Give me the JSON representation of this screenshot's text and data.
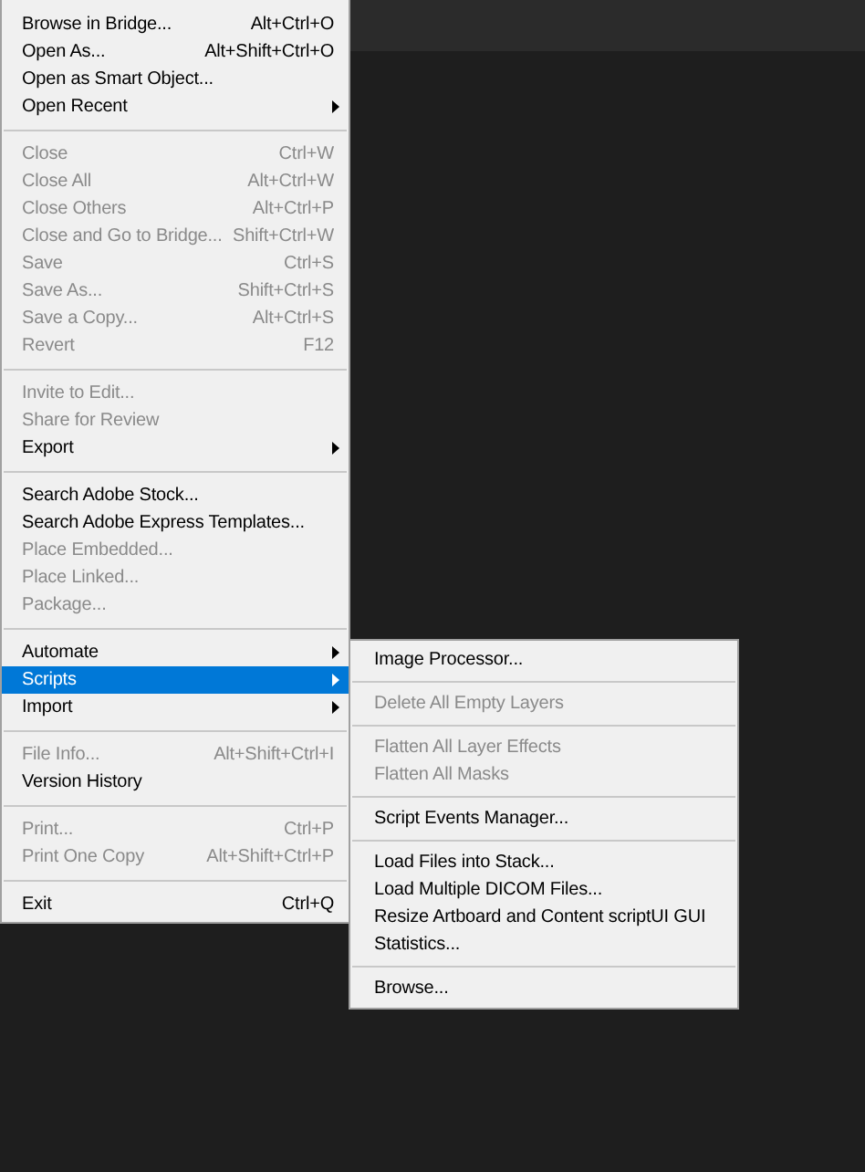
{
  "file_menu": {
    "items": [
      {
        "kind": "item",
        "label": "Browse in Bridge...",
        "shortcut": "Alt+Ctrl+O",
        "disabled": false,
        "has_submenu": false,
        "selected": false
      },
      {
        "kind": "item",
        "label": "Open As...",
        "shortcut": "Alt+Shift+Ctrl+O",
        "disabled": false,
        "has_submenu": false,
        "selected": false
      },
      {
        "kind": "item",
        "label": "Open as Smart Object...",
        "disabled": false,
        "has_submenu": false,
        "selected": false
      },
      {
        "kind": "item",
        "label": "Open Recent",
        "disabled": false,
        "has_submenu": true,
        "selected": false
      },
      {
        "kind": "separator"
      },
      {
        "kind": "item",
        "label": "Close",
        "shortcut": "Ctrl+W",
        "disabled": true,
        "has_submenu": false,
        "selected": false
      },
      {
        "kind": "item",
        "label": "Close All",
        "shortcut": "Alt+Ctrl+W",
        "disabled": true,
        "has_submenu": false,
        "selected": false
      },
      {
        "kind": "item",
        "label": "Close Others",
        "shortcut": "Alt+Ctrl+P",
        "disabled": true,
        "has_submenu": false,
        "selected": false
      },
      {
        "kind": "item",
        "label": "Close and Go to Bridge...",
        "shortcut": "Shift+Ctrl+W",
        "disabled": true,
        "has_submenu": false,
        "selected": false
      },
      {
        "kind": "item",
        "label": "Save",
        "shortcut": "Ctrl+S",
        "disabled": true,
        "has_submenu": false,
        "selected": false
      },
      {
        "kind": "item",
        "label": "Save As...",
        "shortcut": "Shift+Ctrl+S",
        "disabled": true,
        "has_submenu": false,
        "selected": false
      },
      {
        "kind": "item",
        "label": "Save a Copy...",
        "shortcut": "Alt+Ctrl+S",
        "disabled": true,
        "has_submenu": false,
        "selected": false
      },
      {
        "kind": "item",
        "label": "Revert",
        "shortcut": "F12",
        "disabled": true,
        "has_submenu": false,
        "selected": false
      },
      {
        "kind": "separator"
      },
      {
        "kind": "item",
        "label": "Invite to Edit...",
        "disabled": true,
        "has_submenu": false,
        "selected": false
      },
      {
        "kind": "item",
        "label": "Share for Review",
        "disabled": true,
        "has_submenu": false,
        "selected": false
      },
      {
        "kind": "item",
        "label": "Export",
        "disabled": false,
        "has_submenu": true,
        "selected": false
      },
      {
        "kind": "separator"
      },
      {
        "kind": "item",
        "label": "Search Adobe Stock...",
        "disabled": false,
        "has_submenu": false,
        "selected": false
      },
      {
        "kind": "item",
        "label": "Search Adobe Express Templates...",
        "disabled": false,
        "has_submenu": false,
        "selected": false
      },
      {
        "kind": "item",
        "label": "Place Embedded...",
        "disabled": true,
        "has_submenu": false,
        "selected": false
      },
      {
        "kind": "item",
        "label": "Place Linked...",
        "disabled": true,
        "has_submenu": false,
        "selected": false
      },
      {
        "kind": "item",
        "label": "Package...",
        "disabled": true,
        "has_submenu": false,
        "selected": false
      },
      {
        "kind": "separator"
      },
      {
        "kind": "item",
        "label": "Automate",
        "disabled": false,
        "has_submenu": true,
        "selected": false
      },
      {
        "kind": "item",
        "label": "Scripts",
        "disabled": false,
        "has_submenu": true,
        "selected": true
      },
      {
        "kind": "item",
        "label": "Import",
        "disabled": false,
        "has_submenu": true,
        "selected": false
      },
      {
        "kind": "separator"
      },
      {
        "kind": "item",
        "label": "File Info...",
        "shortcut": "Alt+Shift+Ctrl+I",
        "disabled": true,
        "has_submenu": false,
        "selected": false
      },
      {
        "kind": "item",
        "label": "Version History",
        "disabled": false,
        "has_submenu": false,
        "selected": false
      },
      {
        "kind": "separator"
      },
      {
        "kind": "item",
        "label": "Print...",
        "shortcut": "Ctrl+P",
        "disabled": true,
        "has_submenu": false,
        "selected": false
      },
      {
        "kind": "item",
        "label": "Print One Copy",
        "shortcut": "Alt+Shift+Ctrl+P",
        "disabled": true,
        "has_submenu": false,
        "selected": false
      },
      {
        "kind": "separator"
      },
      {
        "kind": "item",
        "label": "Exit",
        "shortcut": "Ctrl+Q",
        "disabled": false,
        "has_submenu": false,
        "selected": false
      }
    ]
  },
  "scripts_submenu": {
    "items": [
      {
        "kind": "item",
        "label": "Image Processor...",
        "disabled": false
      },
      {
        "kind": "separator"
      },
      {
        "kind": "item",
        "label": "Delete All Empty Layers",
        "disabled": true
      },
      {
        "kind": "separator"
      },
      {
        "kind": "item",
        "label": "Flatten All Layer Effects",
        "disabled": true
      },
      {
        "kind": "item",
        "label": "Flatten All Masks",
        "disabled": true
      },
      {
        "kind": "separator"
      },
      {
        "kind": "item",
        "label": "Script Events Manager...",
        "disabled": false
      },
      {
        "kind": "separator"
      },
      {
        "kind": "item",
        "label": "Load Files into Stack...",
        "disabled": false
      },
      {
        "kind": "item",
        "label": "Load Multiple DICOM Files...",
        "disabled": false
      },
      {
        "kind": "item",
        "label": "Resize Artboard and Content scriptUI GUI",
        "disabled": false
      },
      {
        "kind": "item",
        "label": "Statistics...",
        "disabled": false
      },
      {
        "kind": "separator"
      },
      {
        "kind": "item",
        "label": "Browse...",
        "disabled": false
      }
    ]
  }
}
